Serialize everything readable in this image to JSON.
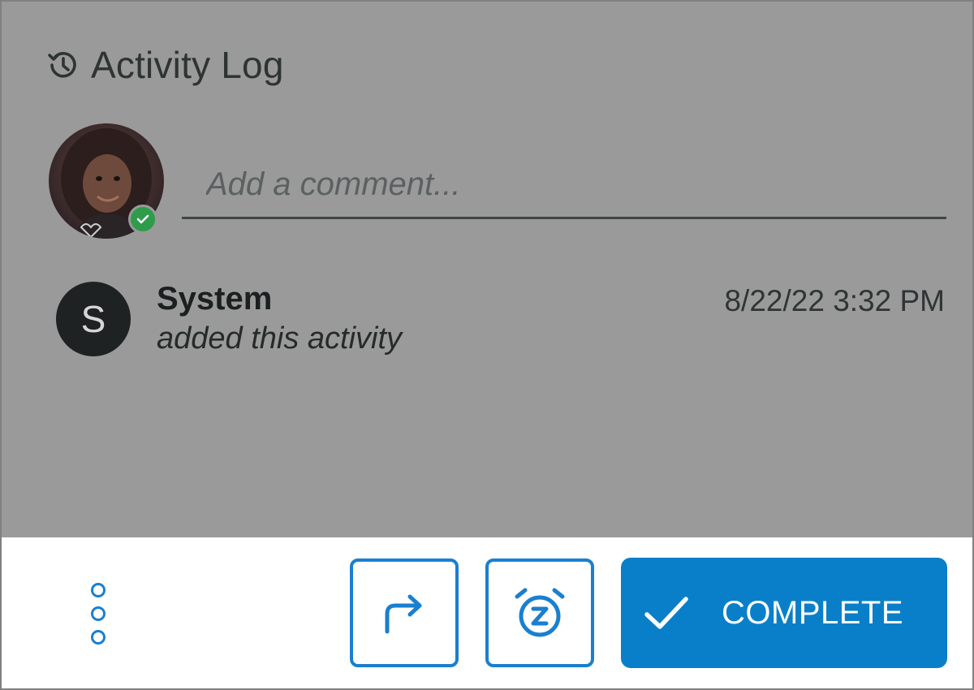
{
  "activity_log": {
    "title": "Activity Log",
    "icon": "history-icon"
  },
  "comment": {
    "placeholder": "Add a comment...",
    "value": "",
    "user_status": "online"
  },
  "entries": [
    {
      "initial": "S",
      "author": "System",
      "action": "added this activity",
      "timestamp": "8/22/22 3:32 PM"
    }
  ],
  "actions": {
    "more_icon": "more-vertical-icon",
    "forward_icon": "forward-arrow-icon",
    "snooze_icon": "snooze-alarm-icon",
    "complete_label": "COMPLETE",
    "complete_icon": "checkmark-icon"
  },
  "colors": {
    "accent": "#0a7fc9",
    "overlay": "#9a9a9a",
    "status_online": "#2e9c4a"
  }
}
